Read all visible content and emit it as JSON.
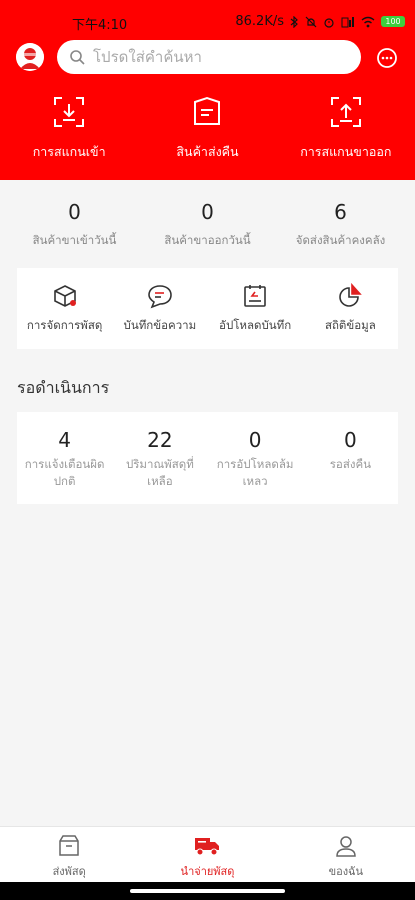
{
  "status_bar": {
    "time": "下午4:10",
    "speed": "86.2K/s",
    "battery": "100"
  },
  "search": {
    "placeholder": "โปรดใส่คำค้นหา"
  },
  "quick_actions": [
    {
      "label": "การสแกนเข้า",
      "icon": "scan-in-icon"
    },
    {
      "label": "สินค้าส่งคืน",
      "icon": "return-goods-icon"
    },
    {
      "label": "การสแกนขาออก",
      "icon": "scan-out-icon"
    }
  ],
  "stats": [
    {
      "value": "0",
      "label": "สินค้าขาเข้าวันนี้"
    },
    {
      "value": "0",
      "label": "สินค้าขาออกวันนี้"
    },
    {
      "value": "6",
      "label": "จัดส่งสินค้าคงคลัง"
    }
  ],
  "tools": [
    {
      "label": "การจัดการพัสดุ",
      "icon": "parcel-box-icon"
    },
    {
      "label": "บันทึกข้อความ",
      "icon": "message-icon"
    },
    {
      "label": "อัปโหลดบันทึก",
      "icon": "upload-record-icon"
    },
    {
      "label": "สถิติข้อมูล",
      "icon": "pie-chart-icon"
    }
  ],
  "pending": {
    "title": "รอดำเนินการ",
    "items": [
      {
        "value": "4",
        "label": "การแจ้งเตือนผิดปกติ"
      },
      {
        "value": "22",
        "label": "ปริมาณพัสดุที่เหลือ"
      },
      {
        "value": "0",
        "label": "การอัปโหลดล้มเหลว"
      },
      {
        "value": "0",
        "label": "รอส่งคืน"
      }
    ]
  },
  "bottom_nav": [
    {
      "label": "ส่งพัสดุ",
      "icon": "send-box-icon",
      "active": false
    },
    {
      "label": "นำจ่ายพัสดุ",
      "icon": "delivery-truck-icon",
      "active": true
    },
    {
      "label": "ของฉัน",
      "icon": "profile-icon",
      "active": false
    }
  ],
  "colors": {
    "brand": "#ff0000",
    "active": "#e02020",
    "background": "#f5f5f5"
  }
}
